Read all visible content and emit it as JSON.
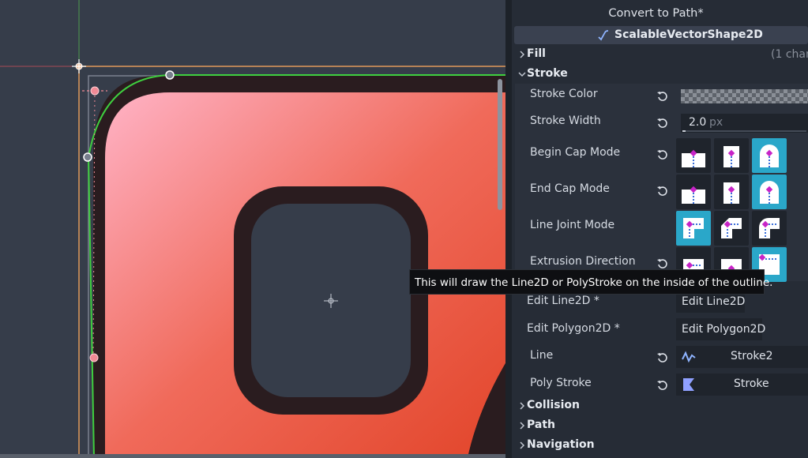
{
  "inspector": {
    "convert_label": "Convert to Path*",
    "node_type": "ScalableVectorShape2D",
    "sections": {
      "fill": "Fill",
      "fill_changes": "(1 chan",
      "stroke": "Stroke",
      "collision": "Collision",
      "path": "Path",
      "navigation": "Navigation"
    },
    "stroke_color": {
      "label": "Stroke Color"
    },
    "stroke_width": {
      "label": "Stroke Width",
      "value": "2.0",
      "unit": "px"
    },
    "begin_cap": {
      "label": "Begin Cap Mode",
      "selected_index": 2
    },
    "end_cap": {
      "label": "End Cap Mode",
      "selected_index": 2
    },
    "line_joint": {
      "label": "Line Joint Mode",
      "selected_index": 0
    },
    "extrusion": {
      "label": "Extrusion Direction",
      "selected_index": 2
    },
    "edit_line2d": {
      "label": "Edit Line2D *",
      "button": "Edit Line2D"
    },
    "edit_polygon2d": {
      "label": "Edit Polygon2D *",
      "button": "Edit Polygon2D"
    },
    "line": {
      "label": "Line",
      "value": "Stroke2"
    },
    "poly_stroke": {
      "label": "Poly Stroke",
      "value": "Stroke"
    }
  },
  "tooltip": "This will draw the Line2D or PolyStroke on the inside of the outline.",
  "colors": {
    "accent": "#2aa7c9",
    "stroke_green": "#3fcf3f",
    "shape_fill_start": "#ffb3c6",
    "shape_fill_end": "#e2452a",
    "outline": "#2a1c1f",
    "handle_pink": "#f08a95"
  }
}
